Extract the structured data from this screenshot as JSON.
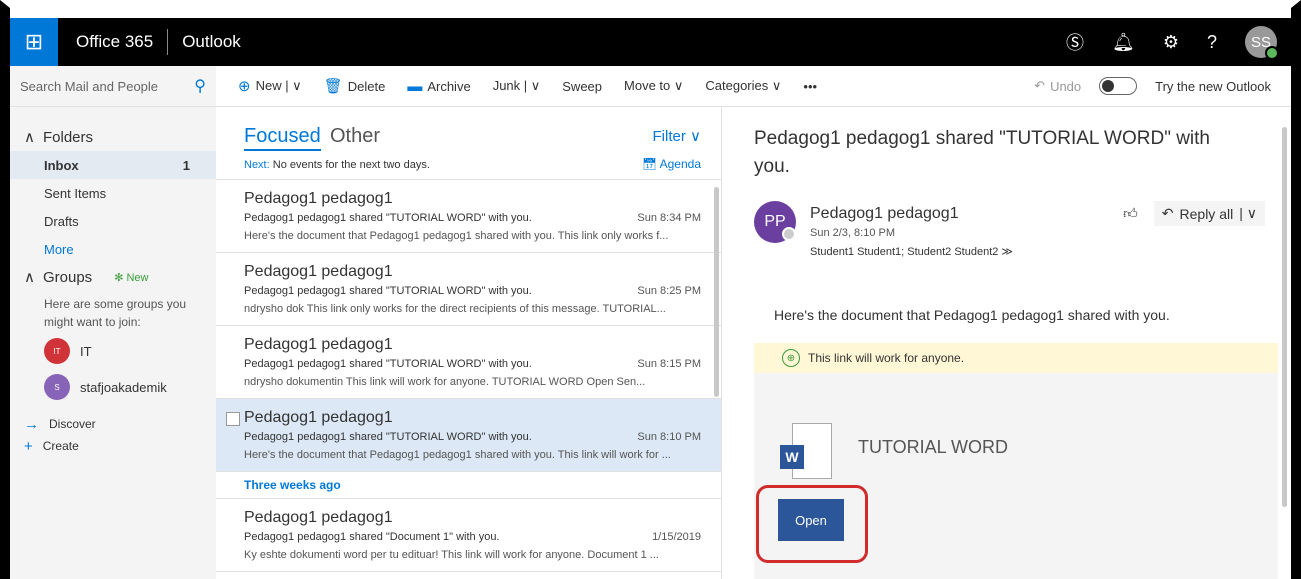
{
  "topbar": {
    "brand": "Office 365",
    "app": "Outlook",
    "avatar_initials": "SS"
  },
  "cmdbar": {
    "search_placeholder": "Search Mail and People",
    "new_label": "New | ∨",
    "delete_label": "Delete",
    "archive_label": "Archive",
    "junk_label": "Junk | ∨",
    "sweep_label": "Sweep",
    "move_label": "Move to ∨",
    "categories_label": "Categories ∨",
    "more_label": "•••",
    "undo_label": "Undo",
    "try_label": "Try the new Outlook"
  },
  "folders": {
    "header": "Folders",
    "items": [
      {
        "label": "Inbox",
        "count": "1"
      },
      {
        "label": "Sent Items",
        "count": ""
      },
      {
        "label": "Drafts",
        "count": ""
      }
    ],
    "more": "More"
  },
  "groups": {
    "header": "Groups",
    "new": "✻ New",
    "hint": "Here are some groups you might want to join:",
    "items": [
      {
        "initials": "IT",
        "name": "IT",
        "color": "#d13438"
      },
      {
        "initials": "S",
        "name": "stafjoakademik",
        "color": "#8764b8"
      }
    ],
    "discover": "Discover",
    "create": "Create"
  },
  "list": {
    "focused": "Focused",
    "other": "Other",
    "filter": "Filter ∨",
    "next_label": "Next:",
    "next_text": "No events for the next two days.",
    "agenda": "Agenda",
    "separator": "Three weeks ago",
    "messages": [
      {
        "from": "Pedagog1 pedagog1",
        "subject": "Pedagog1 pedagog1 shared \"TUTORIAL WORD\" with you.",
        "date": "Sun 8:34 PM",
        "preview": "Here's the document that Pedagog1 pedagog1 shared with you.  This link only works f..."
      },
      {
        "from": "Pedagog1 pedagog1",
        "subject": "Pedagog1 pedagog1 shared \"TUTORIAL WORD\" with you.",
        "date": "Sun 8:25 PM",
        "preview": "ndrysho dok  This link only works for the direct recipients of this message.  TUTORIAL..."
      },
      {
        "from": "Pedagog1 pedagog1",
        "subject": "Pedagog1 pedagog1 shared \"TUTORIAL WORD\" with you.",
        "date": "Sun 8:15 PM",
        "preview": "ndrysho dokumentin  This link will work for anyone.  TUTORIAL WORD   Open     Sen..."
      },
      {
        "from": "Pedagog1 pedagog1",
        "subject": "Pedagog1 pedagog1 shared \"TUTORIAL WORD\" with you.",
        "date": "Sun 8:10 PM",
        "preview": "Here's the document that Pedagog1 pedagog1 shared with you.  This link will work for ..."
      },
      {
        "from": "Pedagog1 pedagog1",
        "subject": "Pedagog1 pedagog1 shared \"Document 1\" with you.",
        "date": "1/15/2019",
        "preview": "Ky eshte dokumenti word per tu edituar!  This link will work for anyone.  Document 1 ..."
      }
    ]
  },
  "reading": {
    "title": "Pedagog1 pedagog1 shared \"TUTORIAL WORD\" with you.",
    "avatar": "PP",
    "from": "Pedagog1 pedagog1",
    "date": "Sun 2/3, 8:10 PM",
    "to": "Student1 Student1; Student2 Student2  ≫",
    "reply_all": "Reply all",
    "body": "Here's the document that Pedagog1 pedagog1 shared with you.",
    "banner": "This link will work for anyone.",
    "doc_name": "TUTORIAL WORD",
    "open": "Open"
  }
}
